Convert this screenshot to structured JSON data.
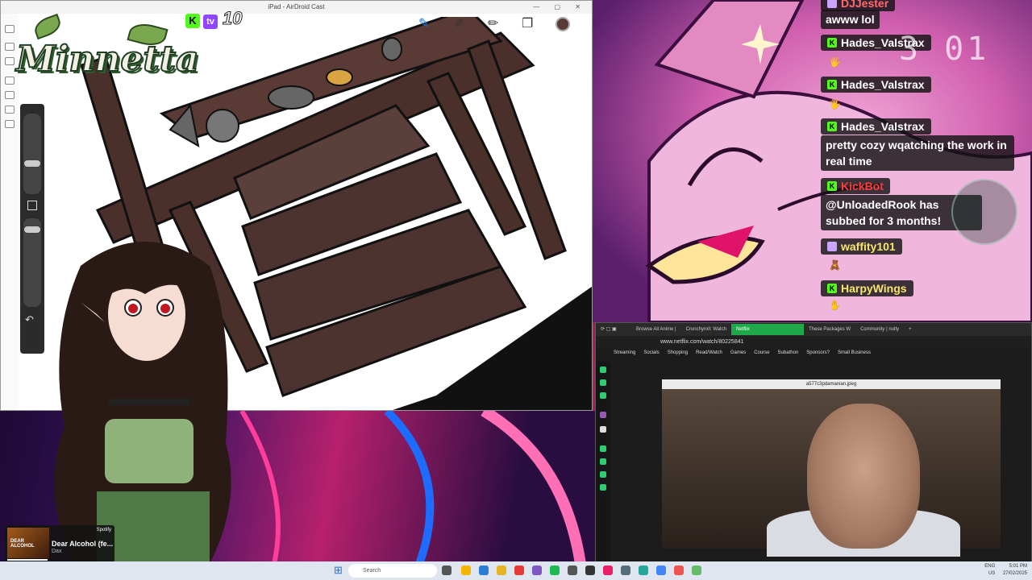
{
  "canvas_window": {
    "title": "iPad - AirDroid Cast",
    "window_controls": "— ▢ ✕"
  },
  "overlay": {
    "logo_text": "Minnetta",
    "kick_badge": "K",
    "twitch_badge": "tv",
    "sub_count": "10"
  },
  "timer": {
    "digits": "3 01"
  },
  "chat": {
    "messages": [
      {
        "user": "DJJester",
        "text": "awww lol"
      },
      {
        "user": "Hades_Valstrax",
        "text": ""
      },
      {
        "user": "Hades_Valstrax",
        "text": ""
      },
      {
        "user": "Hades_Valstrax",
        "text": "pretty cozy wqatching the work in real time"
      },
      {
        "user": "KickBot",
        "text": "@UnloadedRook has subbed for 3 months!"
      },
      {
        "user": "waffity101",
        "text": ""
      },
      {
        "user": "HarpyWings",
        "text": ""
      }
    ]
  },
  "browser": {
    "tabs": [
      "Browse All Anime |",
      "Crunchyroll: Watch",
      "Netflix",
      "These Packages W",
      "Community | nulty"
    ],
    "url": "www.netflix.com/watch/80225841",
    "bookmarks": [
      "Streaming",
      "Socials",
      "Shopping",
      "Read/Watch",
      "Games",
      "Course",
      "Subathon",
      "Sponsors?",
      "Small Business"
    ],
    "video_caption": "a577c3pdamanian.jpeg"
  },
  "spotify": {
    "brand": "Spotify",
    "album_text": "DEAR ALCOHOL",
    "track": "Dear Alcohol (fe...",
    "artist": "Dax"
  },
  "taskbar": {
    "search_placeholder": "Search",
    "tray_lang": "ENG\nUS",
    "tray_time": "5:01 PM",
    "tray_date": "27/02/2025"
  },
  "colors": {
    "kick": "#53fc18",
    "twitch": "#9146ff",
    "netflix_tab": "#1fa84a",
    "kickbot_name": "#ff3b3b"
  }
}
